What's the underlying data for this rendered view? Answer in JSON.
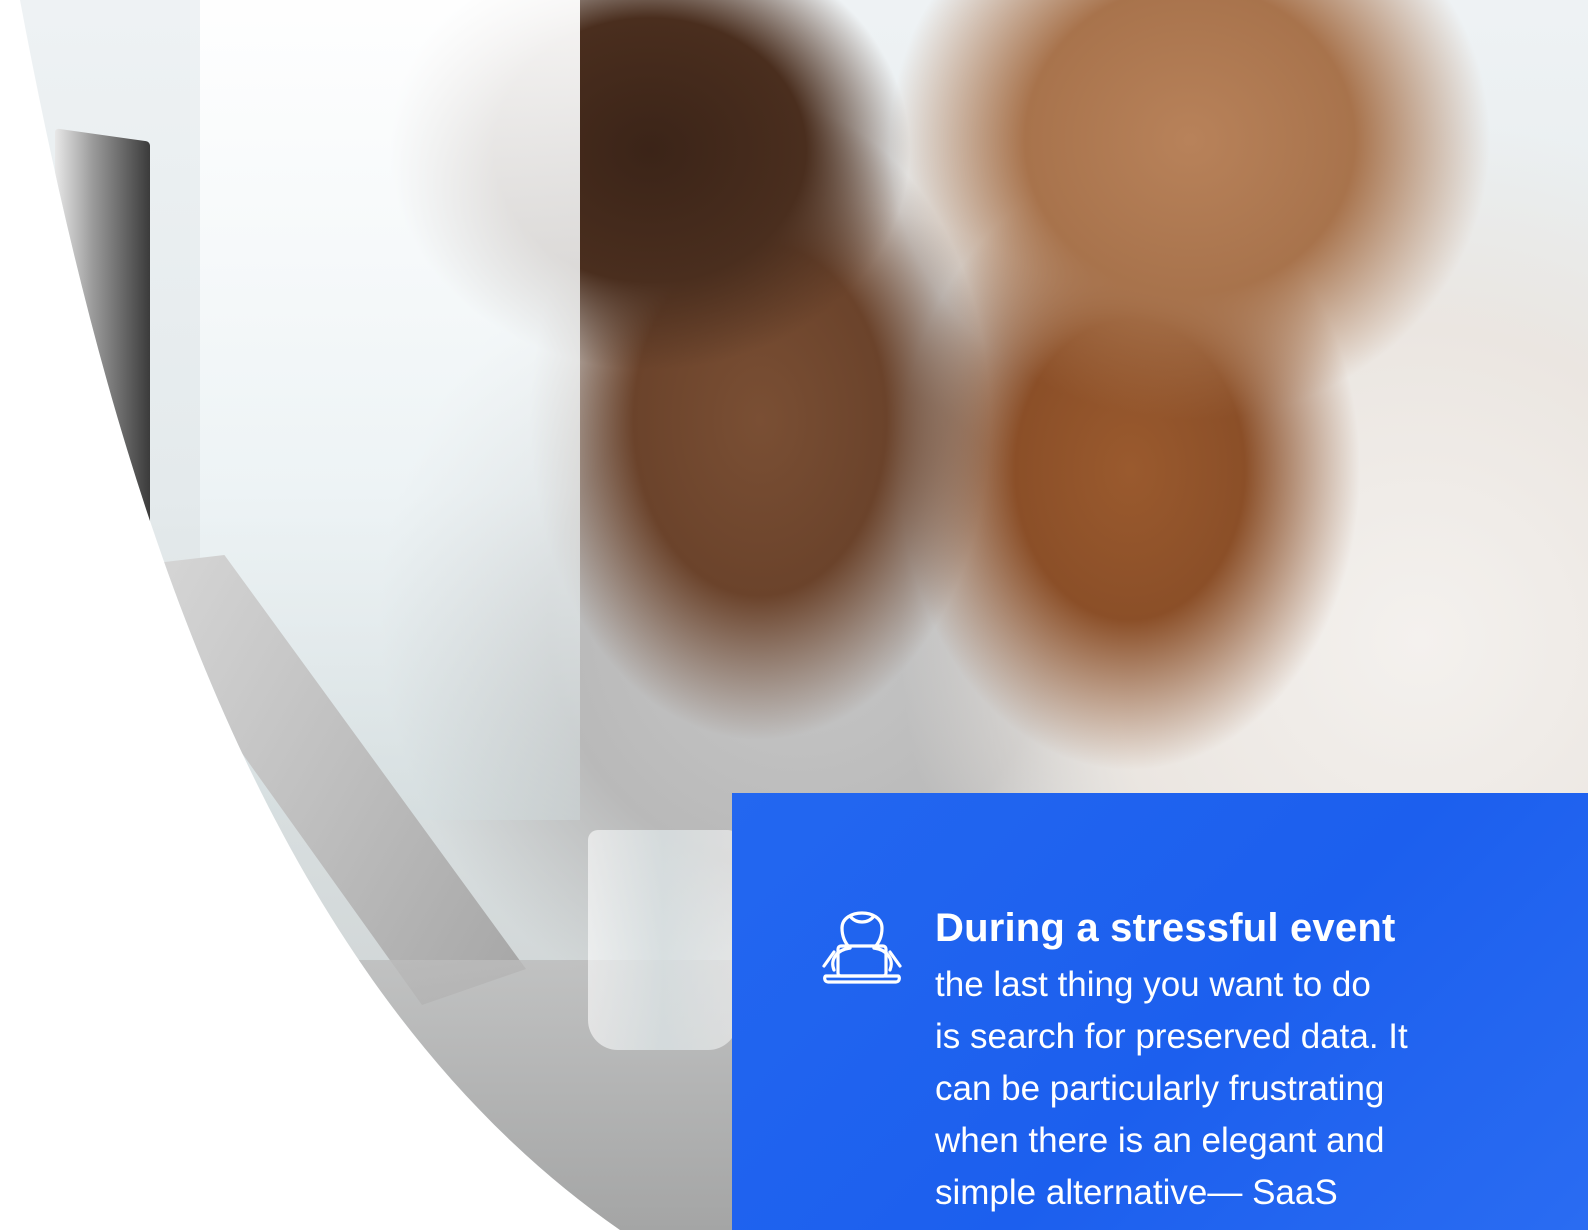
{
  "hero": {
    "photo_label": "Two men looking at a laptop screen in an office",
    "accent_color": "#2367f0"
  },
  "callout": {
    "icon": "person-at-laptop-icon",
    "title": "During a stressful event",
    "body": "the last thing you want to do\nis search for preserved data. It\ncan be particularly frustrating\nwhen there is an elegant and\nsimple alternative— SaaS"
  }
}
